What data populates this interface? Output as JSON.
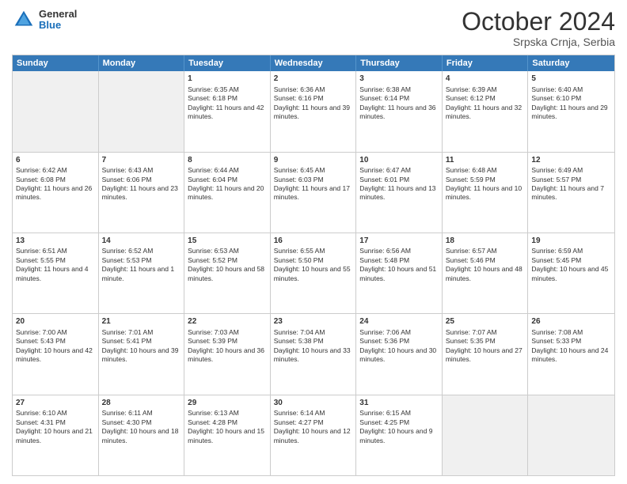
{
  "logo": {
    "general": "General",
    "blue": "Blue"
  },
  "header": {
    "month": "October 2024",
    "location": "Srpska Crnja, Serbia"
  },
  "weekdays": [
    "Sunday",
    "Monday",
    "Tuesday",
    "Wednesday",
    "Thursday",
    "Friday",
    "Saturday"
  ],
  "rows": [
    [
      {
        "day": "",
        "lines": []
      },
      {
        "day": "",
        "lines": []
      },
      {
        "day": "1",
        "lines": [
          "Sunrise: 6:35 AM",
          "Sunset: 6:18 PM",
          "Daylight: 11 hours and 42 minutes."
        ]
      },
      {
        "day": "2",
        "lines": [
          "Sunrise: 6:36 AM",
          "Sunset: 6:16 PM",
          "Daylight: 11 hours and 39 minutes."
        ]
      },
      {
        "day": "3",
        "lines": [
          "Sunrise: 6:38 AM",
          "Sunset: 6:14 PM",
          "Daylight: 11 hours and 36 minutes."
        ]
      },
      {
        "day": "4",
        "lines": [
          "Sunrise: 6:39 AM",
          "Sunset: 6:12 PM",
          "Daylight: 11 hours and 32 minutes."
        ]
      },
      {
        "day": "5",
        "lines": [
          "Sunrise: 6:40 AM",
          "Sunset: 6:10 PM",
          "Daylight: 11 hours and 29 minutes."
        ]
      }
    ],
    [
      {
        "day": "6",
        "lines": [
          "Sunrise: 6:42 AM",
          "Sunset: 6:08 PM",
          "Daylight: 11 hours and 26 minutes."
        ]
      },
      {
        "day": "7",
        "lines": [
          "Sunrise: 6:43 AM",
          "Sunset: 6:06 PM",
          "Daylight: 11 hours and 23 minutes."
        ]
      },
      {
        "day": "8",
        "lines": [
          "Sunrise: 6:44 AM",
          "Sunset: 6:04 PM",
          "Daylight: 11 hours and 20 minutes."
        ]
      },
      {
        "day": "9",
        "lines": [
          "Sunrise: 6:45 AM",
          "Sunset: 6:03 PM",
          "Daylight: 11 hours and 17 minutes."
        ]
      },
      {
        "day": "10",
        "lines": [
          "Sunrise: 6:47 AM",
          "Sunset: 6:01 PM",
          "Daylight: 11 hours and 13 minutes."
        ]
      },
      {
        "day": "11",
        "lines": [
          "Sunrise: 6:48 AM",
          "Sunset: 5:59 PM",
          "Daylight: 11 hours and 10 minutes."
        ]
      },
      {
        "day": "12",
        "lines": [
          "Sunrise: 6:49 AM",
          "Sunset: 5:57 PM",
          "Daylight: 11 hours and 7 minutes."
        ]
      }
    ],
    [
      {
        "day": "13",
        "lines": [
          "Sunrise: 6:51 AM",
          "Sunset: 5:55 PM",
          "Daylight: 11 hours and 4 minutes."
        ]
      },
      {
        "day": "14",
        "lines": [
          "Sunrise: 6:52 AM",
          "Sunset: 5:53 PM",
          "Daylight: 11 hours and 1 minute."
        ]
      },
      {
        "day": "15",
        "lines": [
          "Sunrise: 6:53 AM",
          "Sunset: 5:52 PM",
          "Daylight: 10 hours and 58 minutes."
        ]
      },
      {
        "day": "16",
        "lines": [
          "Sunrise: 6:55 AM",
          "Sunset: 5:50 PM",
          "Daylight: 10 hours and 55 minutes."
        ]
      },
      {
        "day": "17",
        "lines": [
          "Sunrise: 6:56 AM",
          "Sunset: 5:48 PM",
          "Daylight: 10 hours and 51 minutes."
        ]
      },
      {
        "day": "18",
        "lines": [
          "Sunrise: 6:57 AM",
          "Sunset: 5:46 PM",
          "Daylight: 10 hours and 48 minutes."
        ]
      },
      {
        "day": "19",
        "lines": [
          "Sunrise: 6:59 AM",
          "Sunset: 5:45 PM",
          "Daylight: 10 hours and 45 minutes."
        ]
      }
    ],
    [
      {
        "day": "20",
        "lines": [
          "Sunrise: 7:00 AM",
          "Sunset: 5:43 PM",
          "Daylight: 10 hours and 42 minutes."
        ]
      },
      {
        "day": "21",
        "lines": [
          "Sunrise: 7:01 AM",
          "Sunset: 5:41 PM",
          "Daylight: 10 hours and 39 minutes."
        ]
      },
      {
        "day": "22",
        "lines": [
          "Sunrise: 7:03 AM",
          "Sunset: 5:39 PM",
          "Daylight: 10 hours and 36 minutes."
        ]
      },
      {
        "day": "23",
        "lines": [
          "Sunrise: 7:04 AM",
          "Sunset: 5:38 PM",
          "Daylight: 10 hours and 33 minutes."
        ]
      },
      {
        "day": "24",
        "lines": [
          "Sunrise: 7:06 AM",
          "Sunset: 5:36 PM",
          "Daylight: 10 hours and 30 minutes."
        ]
      },
      {
        "day": "25",
        "lines": [
          "Sunrise: 7:07 AM",
          "Sunset: 5:35 PM",
          "Daylight: 10 hours and 27 minutes."
        ]
      },
      {
        "day": "26",
        "lines": [
          "Sunrise: 7:08 AM",
          "Sunset: 5:33 PM",
          "Daylight: 10 hours and 24 minutes."
        ]
      }
    ],
    [
      {
        "day": "27",
        "lines": [
          "Sunrise: 6:10 AM",
          "Sunset: 4:31 PM",
          "Daylight: 10 hours and 21 minutes."
        ]
      },
      {
        "day": "28",
        "lines": [
          "Sunrise: 6:11 AM",
          "Sunset: 4:30 PM",
          "Daylight: 10 hours and 18 minutes."
        ]
      },
      {
        "day": "29",
        "lines": [
          "Sunrise: 6:13 AM",
          "Sunset: 4:28 PM",
          "Daylight: 10 hours and 15 minutes."
        ]
      },
      {
        "day": "30",
        "lines": [
          "Sunrise: 6:14 AM",
          "Sunset: 4:27 PM",
          "Daylight: 10 hours and 12 minutes."
        ]
      },
      {
        "day": "31",
        "lines": [
          "Sunrise: 6:15 AM",
          "Sunset: 4:25 PM",
          "Daylight: 10 hours and 9 minutes."
        ]
      },
      {
        "day": "",
        "lines": []
      },
      {
        "day": "",
        "lines": []
      }
    ]
  ]
}
